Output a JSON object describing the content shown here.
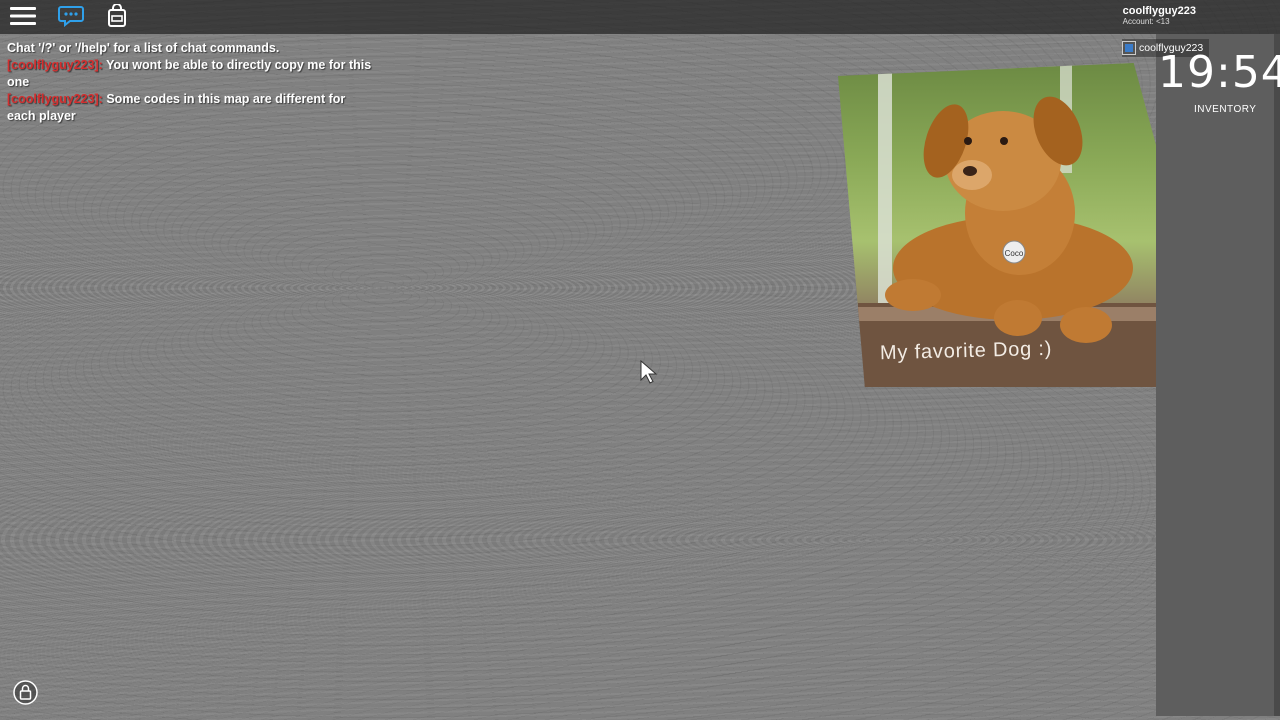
{
  "topbar": {
    "menu_icon": "hamburger-menu-icon",
    "chat_icon": "chat-bubble-icon",
    "backpack_icon": "backpack-icon",
    "account_name": "coolflyguy223",
    "account_sub": "Account: <13"
  },
  "chat": {
    "system": "Chat '/?' or '/help' for a list of chat commands.",
    "messages": [
      {
        "speaker": "[coolflyguy223]:",
        "text": "You wont be able to directly copy me for this one"
      },
      {
        "speaker": "[coolflyguy223]:",
        "text": "Some codes in this map are different for each player"
      }
    ]
  },
  "playerlist": {
    "name": "coolflyguy223"
  },
  "hud": {
    "clock": "19:54",
    "inventory_label": "INVENTORY"
  },
  "picture": {
    "label": "My favorite Dog :)",
    "tag": "Coco"
  },
  "colors": {
    "chat_speaker": "#d32f2f",
    "floor": "#848484",
    "sidepanel": "#5e5e5e"
  }
}
